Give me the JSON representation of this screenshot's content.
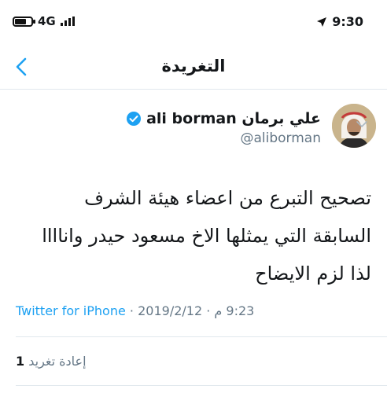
{
  "status_bar": {
    "time": "9:30",
    "network": "4G",
    "battery_level": 0.7
  },
  "nav": {
    "title": "التغريدة",
    "back_icon": "chevron-left-icon"
  },
  "tweet": {
    "display_name": "علي برمان ali borman",
    "handle": "@aliborman",
    "verified": true,
    "text_lines": [
      "تصحيح التبرع من اعضاء هيئة الشرف",
      "السابقة التي يمثلها الاخ مسعود حيدر واناااا",
      "لذا لزم الايضاح"
    ],
    "time": "9:23 م",
    "date": "2019/2/12",
    "source": "Twitter for iPhone",
    "separator": "·",
    "retweet_count": "1",
    "retweet_label": "إعادة تغريد"
  },
  "colors": {
    "accent": "#1da1f2",
    "secondary_text": "#657786",
    "divider": "#e1e8ed"
  }
}
